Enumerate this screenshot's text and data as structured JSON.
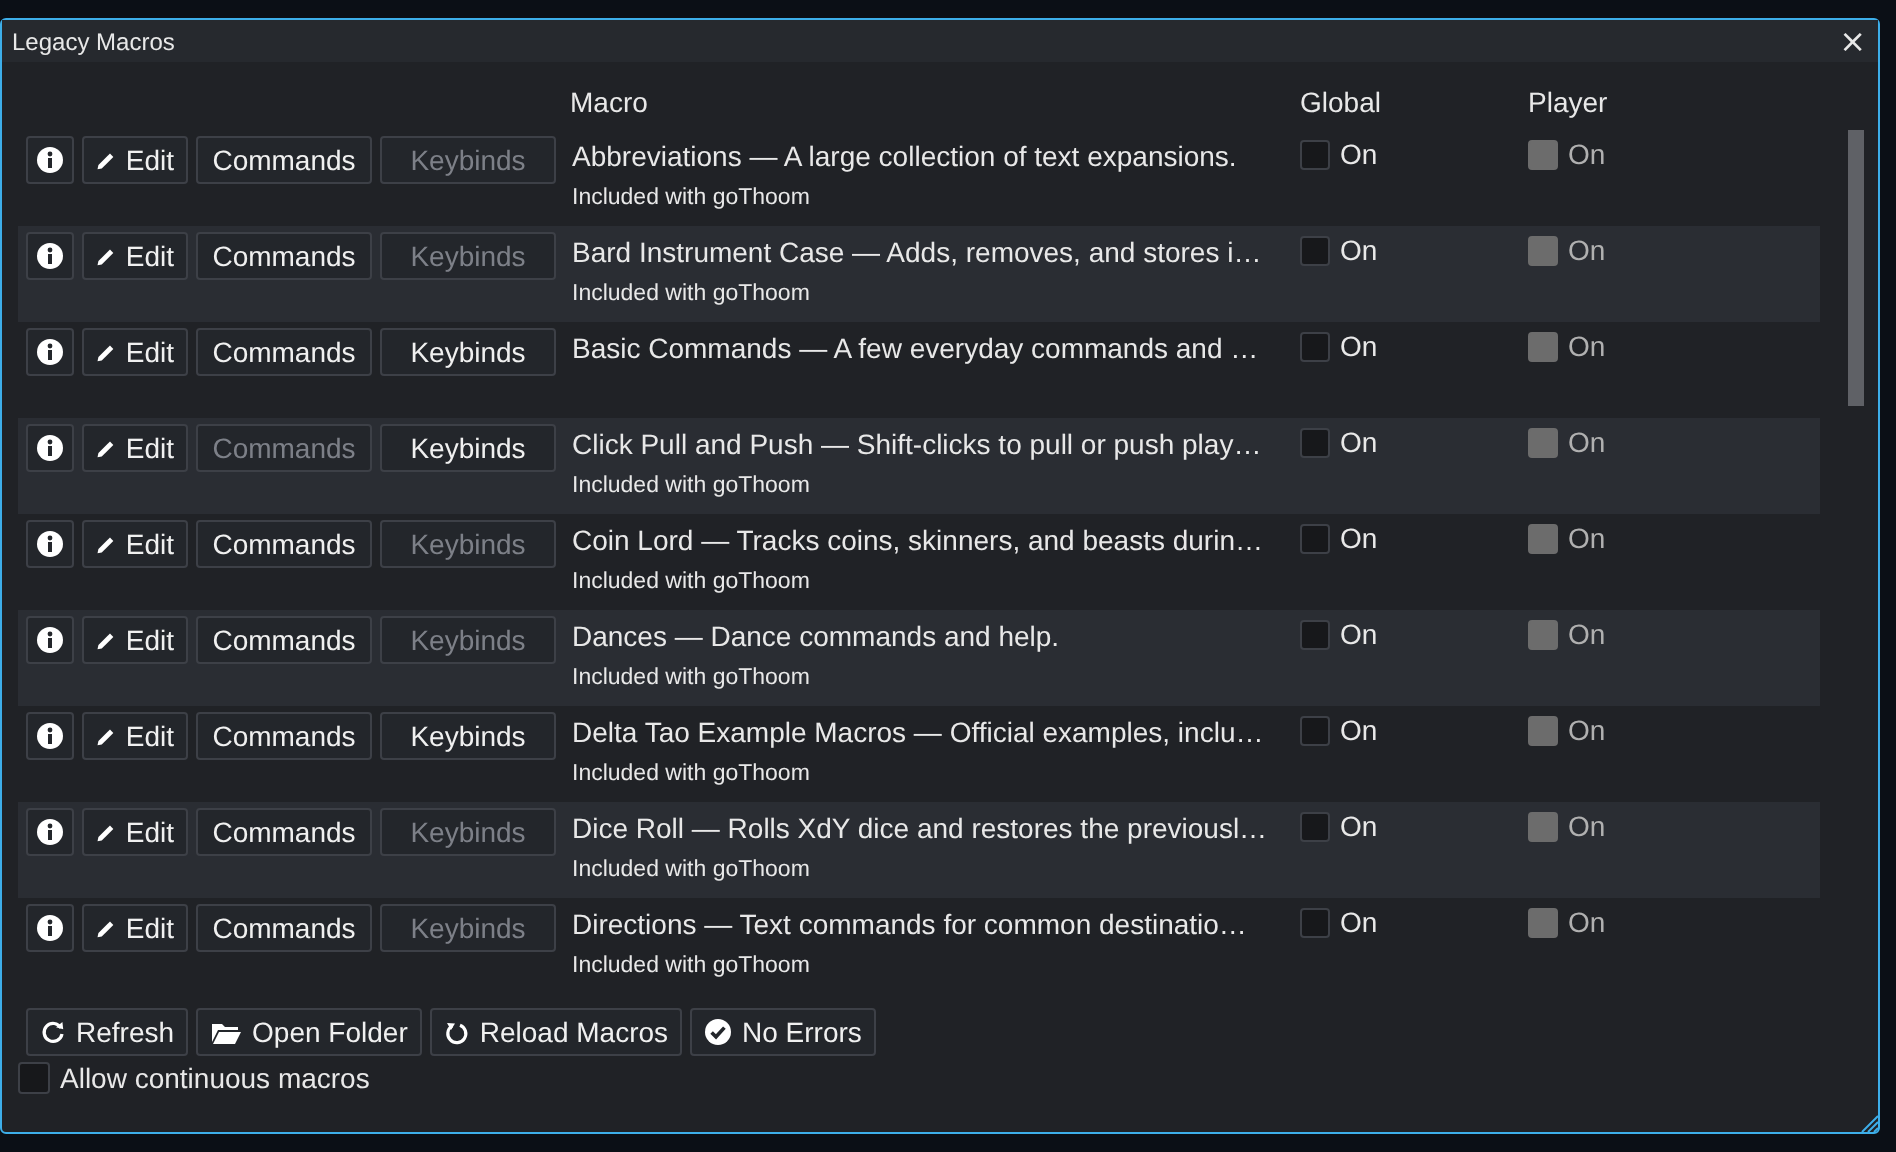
{
  "window": {
    "title": "Legacy Macros",
    "close": "×"
  },
  "columns": [
    "Macro",
    "Global",
    "Player"
  ],
  "rows": [
    {
      "edit": "Edit",
      "commands": {
        "label": "Commands",
        "disabled": false
      },
      "keybinds": {
        "label": "Keybinds",
        "disabled": true
      },
      "title": "Abbreviations — A large collection of text expansions.",
      "source": "Included with goThoom",
      "global": {
        "label": "On",
        "checked": false,
        "disabled": false
      },
      "player": {
        "label": "On",
        "checked": false,
        "disabled": true
      }
    },
    {
      "edit": "Edit",
      "commands": {
        "label": "Commands",
        "disabled": false
      },
      "keybinds": {
        "label": "Keybinds",
        "disabled": true
      },
      "title": "Bard Instrument Case — Adds, removes, and stores i…",
      "source": "Included with goThoom",
      "global": {
        "label": "On",
        "checked": false,
        "disabled": false
      },
      "player": {
        "label": "On",
        "checked": false,
        "disabled": true
      }
    },
    {
      "edit": "Edit",
      "commands": {
        "label": "Commands",
        "disabled": false
      },
      "keybinds": {
        "label": "Keybinds",
        "disabled": false
      },
      "title": "Basic Commands — A few everyday commands and …",
      "global": {
        "label": "On",
        "checked": false,
        "disabled": false
      },
      "player": {
        "label": "On",
        "checked": false,
        "disabled": true
      }
    },
    {
      "edit": "Edit",
      "commands": {
        "label": "Commands",
        "disabled": true
      },
      "keybinds": {
        "label": "Keybinds",
        "disabled": false
      },
      "title": "Click Pull and Push — Shift-clicks to pull or push play…",
      "source": "Included with goThoom",
      "global": {
        "label": "On",
        "checked": false,
        "disabled": false
      },
      "player": {
        "label": "On",
        "checked": false,
        "disabled": true
      }
    },
    {
      "edit": "Edit",
      "commands": {
        "label": "Commands",
        "disabled": false
      },
      "keybinds": {
        "label": "Keybinds",
        "disabled": true
      },
      "title": "Coin Lord — Tracks coins, skinners, and beasts durin…",
      "source": "Included with goThoom",
      "global": {
        "label": "On",
        "checked": false,
        "disabled": false
      },
      "player": {
        "label": "On",
        "checked": false,
        "disabled": true
      }
    },
    {
      "edit": "Edit",
      "commands": {
        "label": "Commands",
        "disabled": false
      },
      "keybinds": {
        "label": "Keybinds",
        "disabled": true
      },
      "title": "Dances — Dance commands and help.",
      "source": "Included with goThoom",
      "global": {
        "label": "On",
        "checked": false,
        "disabled": false
      },
      "player": {
        "label": "On",
        "checked": false,
        "disabled": true
      }
    },
    {
      "edit": "Edit",
      "commands": {
        "label": "Commands",
        "disabled": false
      },
      "keybinds": {
        "label": "Keybinds",
        "disabled": false
      },
      "title": "Delta Tao Example Macros — Official examples, inclu…",
      "source": "Included with goThoom",
      "global": {
        "label": "On",
        "checked": false,
        "disabled": false
      },
      "player": {
        "label": "On",
        "checked": false,
        "disabled": true
      }
    },
    {
      "edit": "Edit",
      "commands": {
        "label": "Commands",
        "disabled": false
      },
      "keybinds": {
        "label": "Keybinds",
        "disabled": true
      },
      "title": "Dice Roll — Rolls XdY dice and restores the previousl…",
      "source": "Included with goThoom",
      "global": {
        "label": "On",
        "checked": false,
        "disabled": false
      },
      "player": {
        "label": "On",
        "checked": false,
        "disabled": true
      }
    },
    {
      "edit": "Edit",
      "commands": {
        "label": "Commands",
        "disabled": false
      },
      "keybinds": {
        "label": "Keybinds",
        "disabled": true
      },
      "title": "Directions — Text commands for common destinatio…",
      "source": "Included with goThoom",
      "global": {
        "label": "On",
        "checked": false,
        "disabled": false
      },
      "player": {
        "label": "On",
        "checked": false,
        "disabled": true
      }
    }
  ],
  "footer_buttons": [
    {
      "kind": "refresh",
      "label": "Refresh"
    },
    {
      "kind": "folder",
      "label": "Open Folder"
    },
    {
      "kind": "reload",
      "label": "Reload Macros"
    },
    {
      "kind": "check",
      "label": "No Errors"
    }
  ],
  "allow_continuous": {
    "label": "Allow continuous macros",
    "checked": false
  }
}
